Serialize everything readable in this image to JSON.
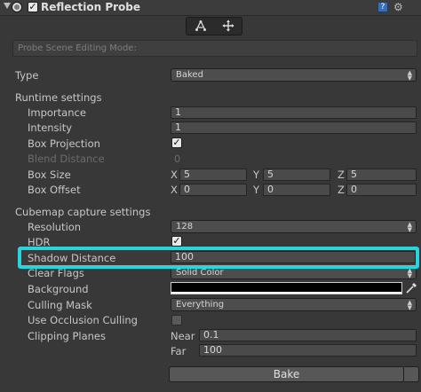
{
  "header": {
    "title": "Reflection Probe",
    "enabled": true
  },
  "mode_bar": {
    "label": "Probe Scene Editing Mode:"
  },
  "type": {
    "label": "Type",
    "value": "Baked"
  },
  "runtime": {
    "heading": "Runtime settings",
    "importance": {
      "label": "Importance",
      "value": "1"
    },
    "intensity": {
      "label": "Intensity",
      "value": "1"
    },
    "box_projection": {
      "label": "Box Projection",
      "checked": true
    },
    "blend_distance": {
      "label": "Blend Distance",
      "value": "0"
    },
    "box_size": {
      "label": "Box Size",
      "x_label": "X",
      "x": "5",
      "y_label": "Y",
      "y": "5",
      "z_label": "Z",
      "z": "5"
    },
    "box_offset": {
      "label": "Box Offset",
      "x_label": "X",
      "x": "0",
      "y_label": "Y",
      "y": "0",
      "z_label": "Z",
      "z": "0"
    }
  },
  "cubemap": {
    "heading": "Cubemap capture settings",
    "resolution": {
      "label": "Resolution",
      "value": "128"
    },
    "hdr": {
      "label": "HDR",
      "checked": true
    },
    "shadow_distance": {
      "label": "Shadow Distance",
      "value": "100"
    },
    "clear_flags": {
      "label": "Clear Flags",
      "value": "Solid Color"
    },
    "background": {
      "label": "Background",
      "color": "#000000"
    },
    "culling_mask": {
      "label": "Culling Mask",
      "value": "Everything"
    },
    "occlusion": {
      "label": "Use Occlusion Culling",
      "checked": false
    },
    "clipping": {
      "label": "Clipping Planes",
      "near_label": "Near",
      "near": "0.1",
      "far_label": "Far",
      "far": "100"
    }
  },
  "bake": {
    "label": "Bake"
  },
  "colors": {
    "highlight": "#28d5dc",
    "panel": "#383838"
  },
  "icons": [
    "foldout-arrow-icon",
    "reflection-probe-icon",
    "help-icon",
    "gear-icon",
    "edit-bounds-icon",
    "move-origin-icon",
    "eyedropper-icon"
  ]
}
